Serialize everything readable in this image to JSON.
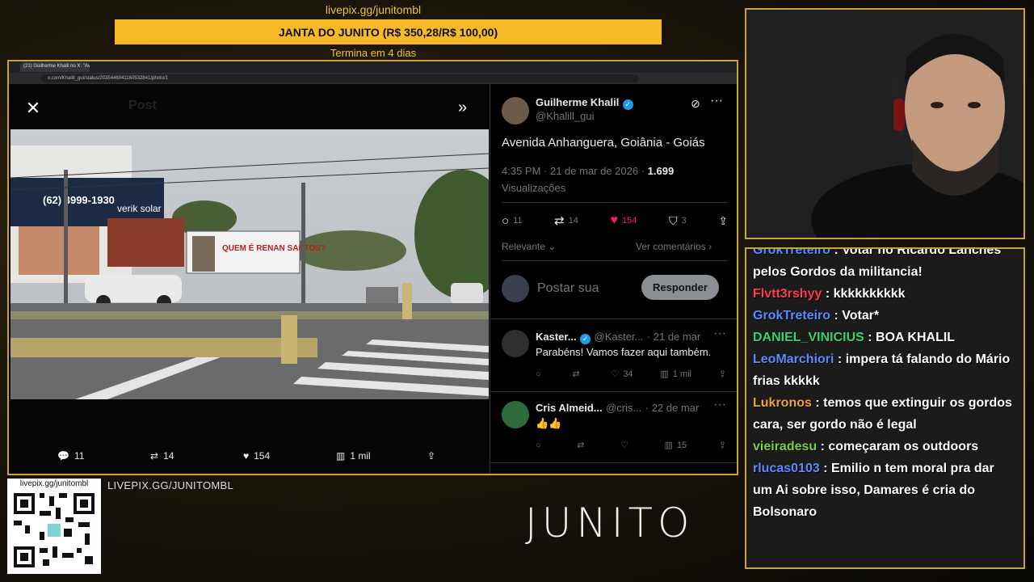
{
  "overlay": {
    "donate_url": "livepix.gg/junitombl",
    "goal_text": "JANTA DO JUNITO (R$ 350,28/R$ 100,00)",
    "ends_text": "Termina em 4 dias"
  },
  "browser": {
    "tab_title": "(21) Guilherme Khalil no X: \"Ave...",
    "address": "x.com/Khalill_gui/status/2035446041160532841/photo/1"
  },
  "viewer": {
    "ghost_title": "Post",
    "actions": {
      "replies": "11",
      "reposts": "14",
      "likes": "154",
      "views": "1 mil"
    },
    "photo_signs": {
      "phone": "(62) 3999-1930",
      "shop": "verik solar",
      "billboard": "QUEM É RENAN SANTOS?"
    }
  },
  "tweet": {
    "author_name": "Guilherme Khalil",
    "author_handle": "@Khalill_gui",
    "text": "Avenida Anhanguera, Goiânia - Goiás",
    "time": "4:35 PM · 21 de mar de 2026 · ",
    "views_count": "1.699",
    "views_label": "Visualizações",
    "replies": "11",
    "reposts": "14",
    "likes": "154",
    "bookmarks": "3",
    "sort_label": "Relevante",
    "see_replies": "Ver comentários",
    "reply_placeholder": "Postar sua",
    "reply_button": "Responder"
  },
  "replies": [
    {
      "name": "Kaster...",
      "handle": "@Kaster...",
      "date": "· 21 de mar",
      "text": "Parabéns! Vamos fazer aqui também.",
      "replies": "",
      "reposts": "",
      "likes": "34",
      "views": "1 mil"
    },
    {
      "name": "Cris Almeid...",
      "handle": "@cris...",
      "date": "· 22 de mar",
      "text": "👍👍",
      "replies": "",
      "reposts": "",
      "likes": "",
      "views": "15"
    }
  ],
  "stream": {
    "qr_url": "livepix.gg/junitombl",
    "livepix_caps": "LIVEPIX.GG/JUNITOMBL",
    "brand": "JUNITO"
  },
  "chat": [
    {
      "user": "GrokTreteiro",
      "color": "#5b8cff",
      "text": "Votar no Ricardo Lanches pelos Gordos da militancia!"
    },
    {
      "user": "Flvtt3rshyy",
      "color": "#ff3b4a",
      "text": "kkkkkkkkkk"
    },
    {
      "user": "GrokTreteiro",
      "color": "#5b8cff",
      "text": "Votar*"
    },
    {
      "user": "DANIEL_VINICIUS",
      "color": "#3bd16f",
      "text": "BOA KHALIL"
    },
    {
      "user": "LeoMarchiori",
      "color": "#5b8cff",
      "text": "impera tá falando do Mário frias kkkkk"
    },
    {
      "user": "Lukronos",
      "color": "#f2a23a",
      "text": "temos que extinguir os gordos cara, ser gordo não é legal"
    },
    {
      "user": "vieiradesu",
      "color": "#7bd13b",
      "text": "começaram os outdoors"
    },
    {
      "user": "rlucas0103",
      "color": "#5b8cff",
      "text": "Emilio n tem moral pra dar um Ai sobre isso, Damares é cria do Bolsonaro"
    }
  ],
  "colors": {
    "accent_gold": "#c8a23a",
    "donate_bar": "#f7b928",
    "x_blue": "#1d9bf0",
    "like_pink": "#f91880"
  }
}
